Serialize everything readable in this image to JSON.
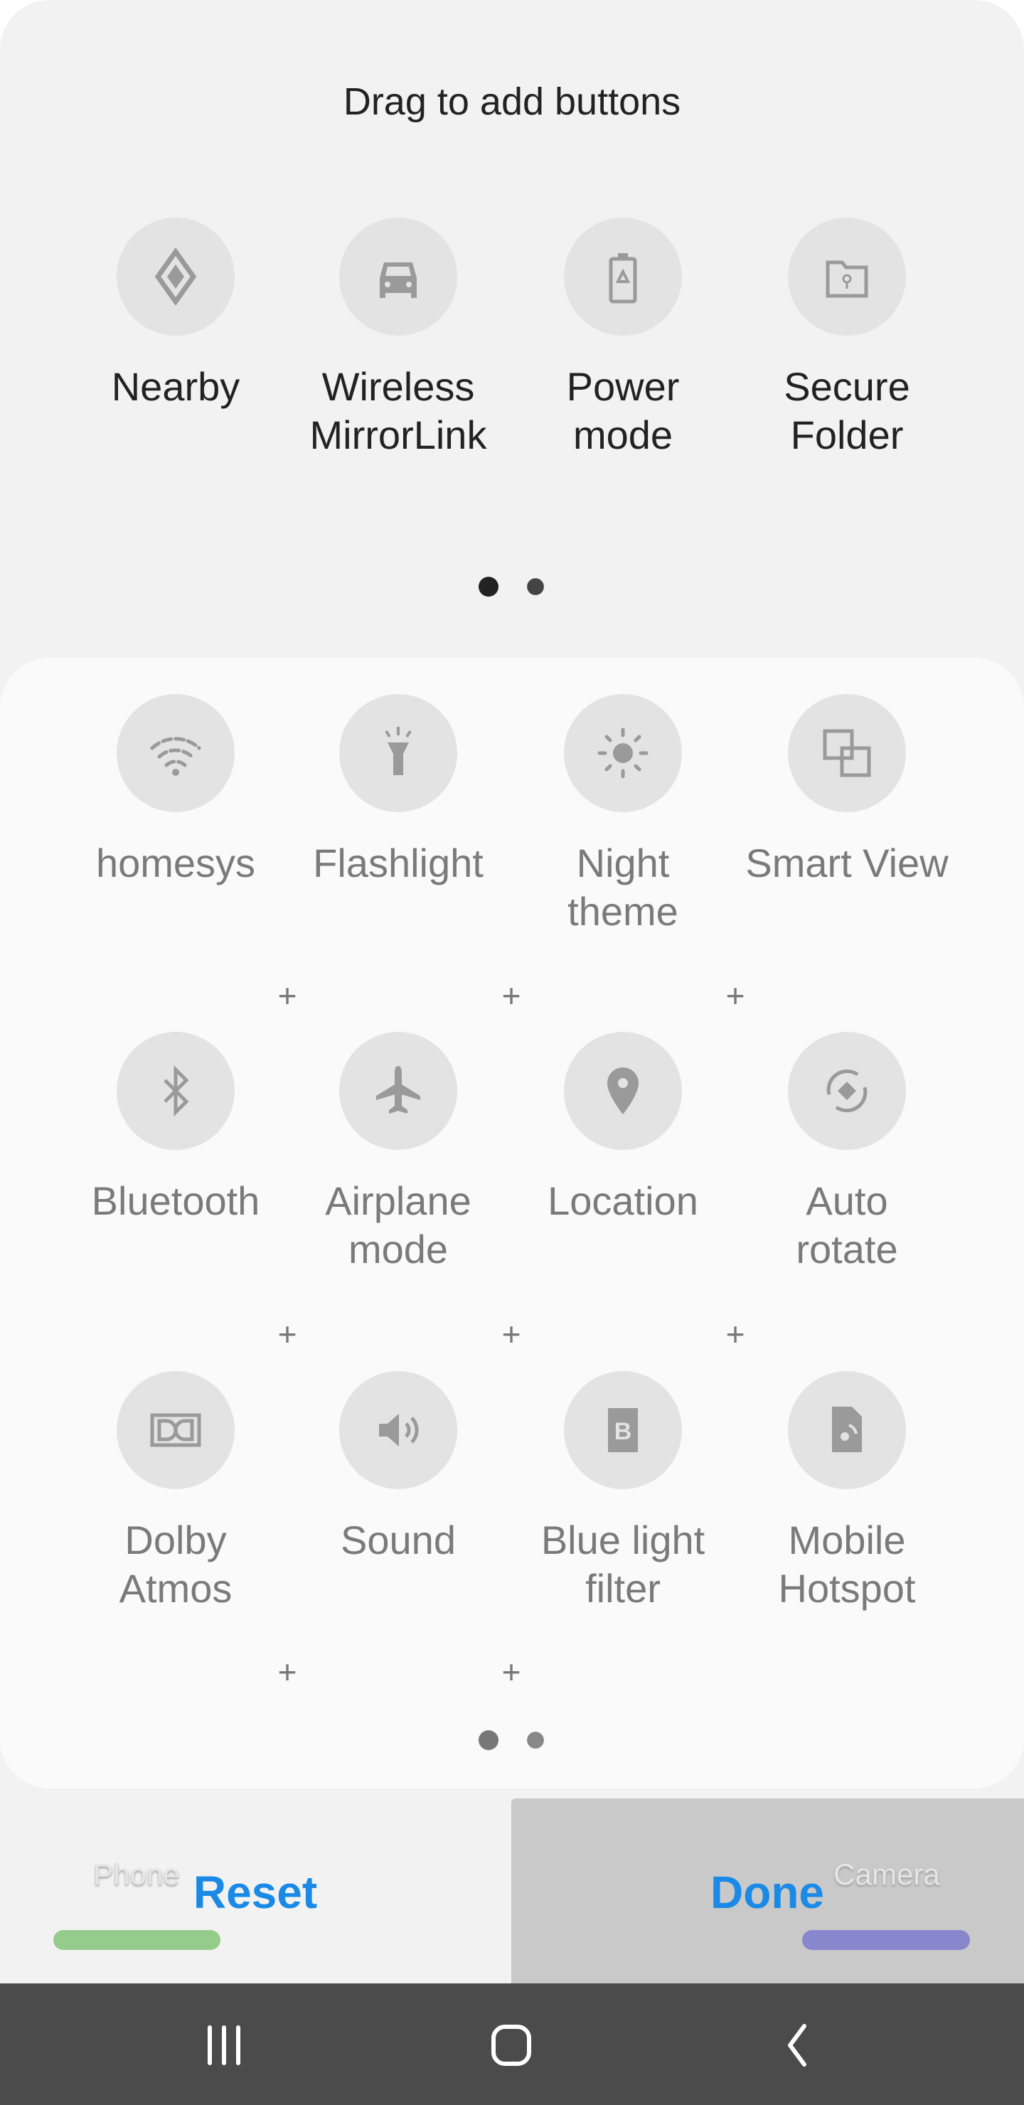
{
  "header": {
    "title": "Drag to add buttons"
  },
  "available_buttons": [
    {
      "label": [
        "Nearby",
        ""
      ],
      "icon": "nearby-diamond-icon"
    },
    {
      "label": [
        "Wireless",
        "MirrorLink"
      ],
      "icon": "car-icon"
    },
    {
      "label": [
        "Power",
        "mode"
      ],
      "icon": "battery-recycle-icon"
    },
    {
      "label": [
        "Secure",
        "Folder"
      ],
      "icon": "secure-folder-icon"
    }
  ],
  "available_pager": {
    "pages": 2,
    "current": 1
  },
  "active_buttons": [
    {
      "label": [
        "homesys",
        ""
      ],
      "icon": "wifi-icon"
    },
    {
      "label": [
        "Flashlight",
        ""
      ],
      "icon": "flashlight-icon"
    },
    {
      "label": [
        "Night",
        "theme"
      ],
      "icon": "night-theme-icon"
    },
    {
      "label": [
        "Smart View",
        ""
      ],
      "icon": "smart-view-icon"
    },
    {
      "label": [
        "Bluetooth",
        ""
      ],
      "icon": "bluetooth-icon"
    },
    {
      "label": [
        "Airplane",
        "mode"
      ],
      "icon": "airplane-icon"
    },
    {
      "label": [
        "Location",
        ""
      ],
      "icon": "location-pin-icon"
    },
    {
      "label": [
        "Auto",
        "rotate"
      ],
      "icon": "auto-rotate-icon"
    },
    {
      "label": [
        "Dolby",
        "Atmos"
      ],
      "icon": "dolby-icon"
    },
    {
      "label": [
        "Sound",
        ""
      ],
      "icon": "sound-icon"
    },
    {
      "label": [
        "Blue light",
        "filter"
      ],
      "icon": "blue-light-filter-icon"
    },
    {
      "label": [
        "Mobile",
        "Hotspot"
      ],
      "icon": "hotspot-icon"
    }
  ],
  "active_pager": {
    "pages": 2,
    "current": 1
  },
  "footer": {
    "reset": "Reset",
    "done": "Done",
    "ghost_left": "Phone",
    "ghost_right": "Camera",
    "accent": "#1a8ae6"
  }
}
